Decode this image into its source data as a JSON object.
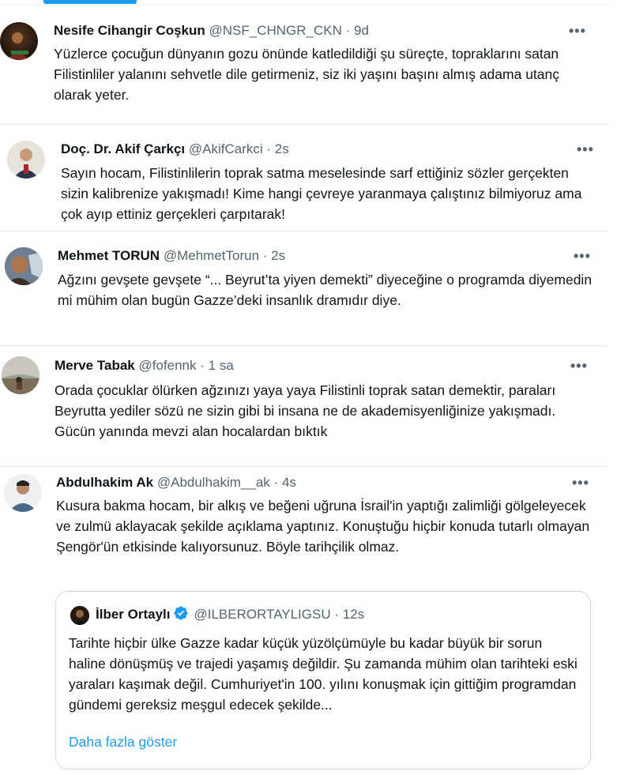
{
  "tweets": [
    {
      "name": "Nesife Cihangir Coşkun",
      "handle": "@NSF_CHNGR_CKN",
      "dot": "·",
      "time": "9d",
      "text": "Yüzlerce çocuğun dünyanın gozu önünde katledildiği şu süreçte, topraklarını satan Filistinliler yalanını  sehvetle dile getirmeniz, siz iki yaşını başını almış  adama utanç olarak yeter."
    },
    {
      "name": "Doç. Dr. Akif Çarkçı",
      "handle": "@AkifCarkci",
      "dot": "·",
      "time": "2s",
      "text": "Sayın hocam, Filistinlilerin toprak satma meselesinde sarf ettiğiniz sözler gerçekten sizin kalibrenize yakışmadı! Kime hangi çevreye yaranmaya çalıştınız bilmiyoruz ama çok ayıp ettiniz gerçekleri çarpıtarak!"
    },
    {
      "name": "Mehmet TORUN",
      "handle": "@MehmetTorun",
      "dot": "·",
      "time": "2s",
      "text": "Ağzını gevşete gevşete “... Beyrut’ta yiyen demekti” diyeceğine o programda diyemedin mi mühim olan bugün Gazze’deki insanlık dramıdır diye."
    },
    {
      "name": "Merve Tabak",
      "handle": "@fofennk",
      "dot": "·",
      "time": "1 sa",
      "text": "Orada çocuklar ölürken ağzınızı yaya yaya Filistinli toprak satan demektir, paraları Beyrutta yediler sözü ne sizin gibi bi insana ne de akademisyenliğinize yakışmadı. Gücün yanında mevzi alan hocalardan bıktık"
    },
    {
      "name": "Abdulhakim Ak",
      "handle": "@Abdulhakim__ak",
      "dot": "·",
      "time": "4s",
      "text": "Kusura bakma hocam, bir alkış ve beğeni uğruna İsrail'in yaptığı zalimliği gölgeleyecek ve zulmü aklayacak şekilde açıklama yaptınız. Konuştuğu hiçbir konuda tutarlı olmayan Şengör'ün etkisinde kalıyorsunuz. Böyle tarihçilik olmaz."
    }
  ],
  "more_label": "•••",
  "quote": {
    "name": "İlber Ortaylı",
    "handle": "@ILBERORTAYLIGSU",
    "dot": "·",
    "time": "12s",
    "text": "Tarihte hiçbir ülke Gazze kadar küçük yüzölçümüyle bu kadar büyük bir sorun haline dönüşmüş ve trajedi yaşamış değildir. Şu zamanda mühim olan tarihteki eski yaraları kaşımak değil. Cumhuriyet'in 100. yılını konuşmak için gittiğim programdan gündemi gereksiz meşgul edecek şekilde...",
    "show_more": "Daha fazla göster"
  },
  "icons": {
    "verified": "verified-badge-icon",
    "more": "more-horizontal-icon"
  },
  "colors": {
    "accent": "#1d9bf0",
    "secondary_text": "#536471",
    "primary_text": "#0f1419",
    "border": "#cfd9de"
  }
}
